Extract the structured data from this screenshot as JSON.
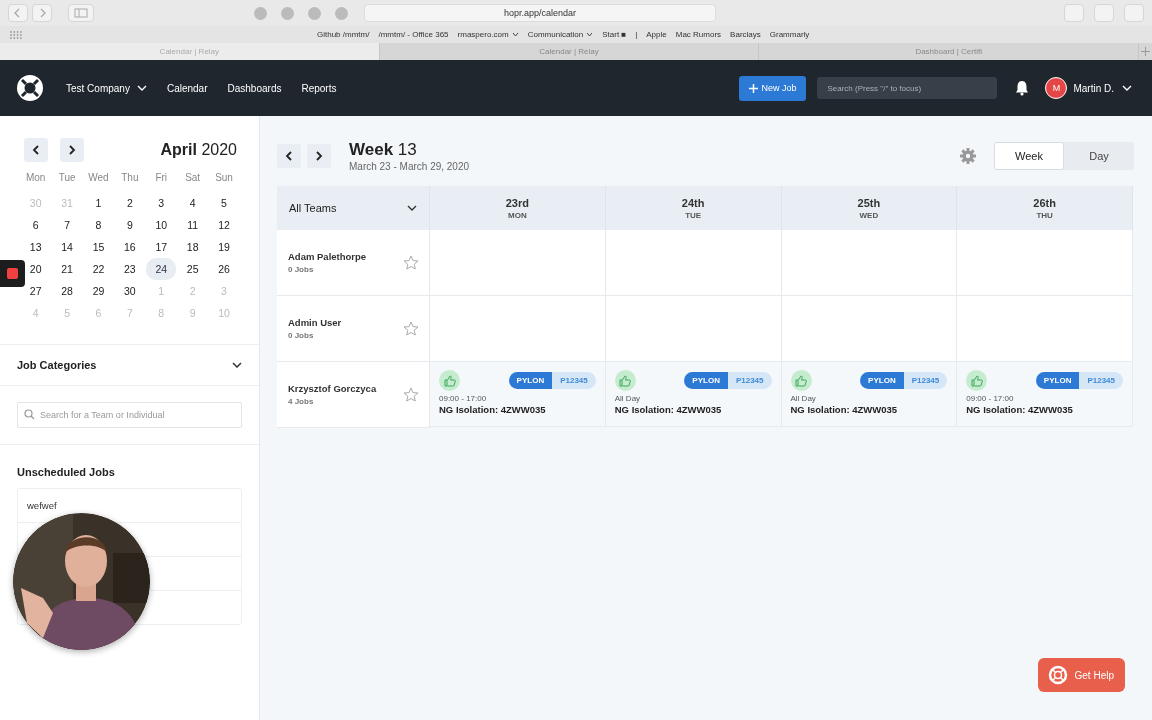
{
  "browser": {
    "url": "hopr.app/calendar",
    "bookmarks": [
      {
        "label": "Github /mmtm/",
        "dropdown": false
      },
      {
        "label": "/mmtm/ - Office 365",
        "dropdown": false
      },
      {
        "label": "rmaspero.com",
        "dropdown": true
      },
      {
        "label": "Communication",
        "dropdown": true
      },
      {
        "label": "Start ■",
        "dropdown": false
      },
      {
        "label": "|",
        "dropdown": false
      },
      {
        "label": "Apple",
        "dropdown": false
      },
      {
        "label": "Mac Rumors",
        "dropdown": false
      },
      {
        "label": "Barclays",
        "dropdown": false
      },
      {
        "label": "Grammarly",
        "dropdown": false
      }
    ],
    "tabs": [
      {
        "label": "Calendar | Relay",
        "selected": true
      },
      {
        "label": "Calendar | Relay",
        "selected": false
      },
      {
        "label": "Dashboard | Certifi",
        "selected": false
      }
    ]
  },
  "nav": {
    "company": "Test Company",
    "links": [
      "Calendar",
      "Dashboards",
      "Reports"
    ],
    "new_job": "New Job",
    "search_placeholder": "Search (Press \"/\" to focus)",
    "user_initial": "M",
    "user_name": "Martin D."
  },
  "mini_calendar": {
    "title": "**April** 2020",
    "weekdays": [
      "Mon",
      "Tue",
      "Wed",
      "Thu",
      "Fri",
      "Sat",
      "Sun"
    ],
    "days": [
      {
        "label": "30",
        "muted": true,
        "selected": false
      },
      {
        "label": "31",
        "muted": true,
        "selected": false
      },
      {
        "label": "1",
        "muted": false,
        "selected": false
      },
      {
        "label": "2",
        "muted": false,
        "selected": false
      },
      {
        "label": "3",
        "muted": false,
        "selected": false
      },
      {
        "label": "4",
        "muted": false,
        "selected": false
      },
      {
        "label": "5",
        "muted": false,
        "selected": false
      },
      {
        "label": "6",
        "muted": false,
        "selected": false
      },
      {
        "label": "7",
        "muted": false,
        "selected": false
      },
      {
        "label": "8",
        "muted": false,
        "selected": false
      },
      {
        "label": "9",
        "muted": false,
        "selected": false
      },
      {
        "label": "10",
        "muted": false,
        "selected": false
      },
      {
        "label": "11",
        "muted": false,
        "selected": false
      },
      {
        "label": "12",
        "muted": false,
        "selected": false
      },
      {
        "label": "13",
        "muted": false,
        "selected": false
      },
      {
        "label": "14",
        "muted": false,
        "selected": false
      },
      {
        "label": "15",
        "muted": false,
        "selected": false
      },
      {
        "label": "16",
        "muted": false,
        "selected": false
      },
      {
        "label": "17",
        "muted": false,
        "selected": false
      },
      {
        "label": "18",
        "muted": false,
        "selected": false
      },
      {
        "label": "19",
        "muted": false,
        "selected": false
      },
      {
        "label": "20",
        "muted": false,
        "selected": false
      },
      {
        "label": "21",
        "muted": false,
        "selected": false
      },
      {
        "label": "22",
        "muted": false,
        "selected": false
      },
      {
        "label": "23",
        "muted": false,
        "selected": false
      },
      {
        "label": "24",
        "muted": false,
        "selected": true
      },
      {
        "label": "25",
        "muted": false,
        "selected": false
      },
      {
        "label": "26",
        "muted": false,
        "selected": false
      },
      {
        "label": "27",
        "muted": false,
        "selected": false
      },
      {
        "label": "28",
        "muted": false,
        "selected": false
      },
      {
        "label": "29",
        "muted": false,
        "selected": false
      },
      {
        "label": "30",
        "muted": false,
        "selected": false
      },
      {
        "label": "1",
        "muted": true,
        "selected": false
      },
      {
        "label": "2",
        "muted": true,
        "selected": false
      },
      {
        "label": "3",
        "muted": true,
        "selected": false
      },
      {
        "label": "4",
        "muted": true,
        "selected": false
      },
      {
        "label": "5",
        "muted": true,
        "selected": false
      },
      {
        "label": "6",
        "muted": true,
        "selected": false
      },
      {
        "label": "7",
        "muted": true,
        "selected": false
      },
      {
        "label": "8",
        "muted": true,
        "selected": false
      },
      {
        "label": "9",
        "muted": true,
        "selected": false
      },
      {
        "label": "10",
        "muted": true,
        "selected": false
      }
    ]
  },
  "job_categories": {
    "title": "Job Categories",
    "search_placeholder": "Search for a Team or Individual"
  },
  "unscheduled": {
    "title": "Unscheduled Jobs",
    "items": [
      "wefwef"
    ]
  },
  "week": {
    "title": "**Week** 13",
    "range": "March 23 - March 29, 2020",
    "views": [
      {
        "label": "Week",
        "selected": true
      },
      {
        "label": "Day",
        "selected": false
      }
    ],
    "team_filter": "All Teams",
    "days": [
      {
        "date": "23rd",
        "weekday": "MON"
      },
      {
        "date": "24th",
        "weekday": "TUE"
      },
      {
        "date": "25th",
        "weekday": "WED"
      },
      {
        "date": "26th",
        "weekday": "THU"
      }
    ],
    "rows": [
      {
        "name": "Adam Palethorpe",
        "jobs": "0 Jobs",
        "starred": false,
        "entries": []
      },
      {
        "name": "Admin User",
        "jobs": "0 Jobs",
        "starred": false,
        "entries": []
      },
      {
        "name": "Krzysztof Gorczyca",
        "jobs": "4 Jobs",
        "starred": false,
        "entries": [
          {
            "time": "09:00 - 17:00",
            "tag": "PYLON",
            "code": "P12345",
            "title": "NG Isolation: 4ZWW035"
          },
          {
            "time": "All Day",
            "tag": "PYLON",
            "code": "P12345",
            "title": "NG Isolation: 4ZWW035"
          },
          {
            "time": "All Day",
            "tag": "PYLON",
            "code": "P12345",
            "title": "NG Isolation: 4ZWW035"
          },
          {
            "time": "09:00 - 17:00",
            "tag": "PYLON",
            "code": "P12345",
            "title": "NG Isolation: 4ZWW035"
          }
        ]
      }
    ]
  },
  "help": "Get Help"
}
